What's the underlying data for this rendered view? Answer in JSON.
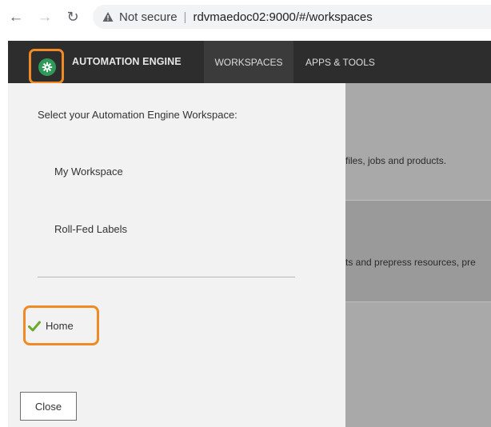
{
  "browser": {
    "security_label": "Not secure",
    "separator": "|",
    "url": "rdvmaedoc02:9000/#/workspaces",
    "icons": {
      "back": "arrow-left-icon",
      "forward": "arrow-right-icon",
      "reload": "reload-icon",
      "warning": "warning-triangle-icon"
    }
  },
  "header": {
    "logo_icon": "gear-icon",
    "brand": "AUTOMATION ENGINE",
    "tabs": [
      {
        "label": "WORKSPACES",
        "active": true
      },
      {
        "label": "APPS & TOOLS",
        "active": false
      }
    ]
  },
  "workspace_menu": {
    "title": "Select your Automation Engine Workspace:",
    "items": [
      {
        "label": "My Workspace"
      },
      {
        "label": "Roll-Fed Labels"
      }
    ],
    "current": {
      "label": "Home",
      "icon": "checkmark-icon"
    },
    "close_label": "Close"
  },
  "background_page": {
    "sections": [
      {
        "text": "files, jobs and products."
      },
      {
        "text": "ts and prepress resources, pre"
      }
    ]
  },
  "colors": {
    "highlight": "#f08a24",
    "header_bg": "#2d2d2d",
    "logo_green": "#2f9a57",
    "check_green": "#6aab2e"
  }
}
